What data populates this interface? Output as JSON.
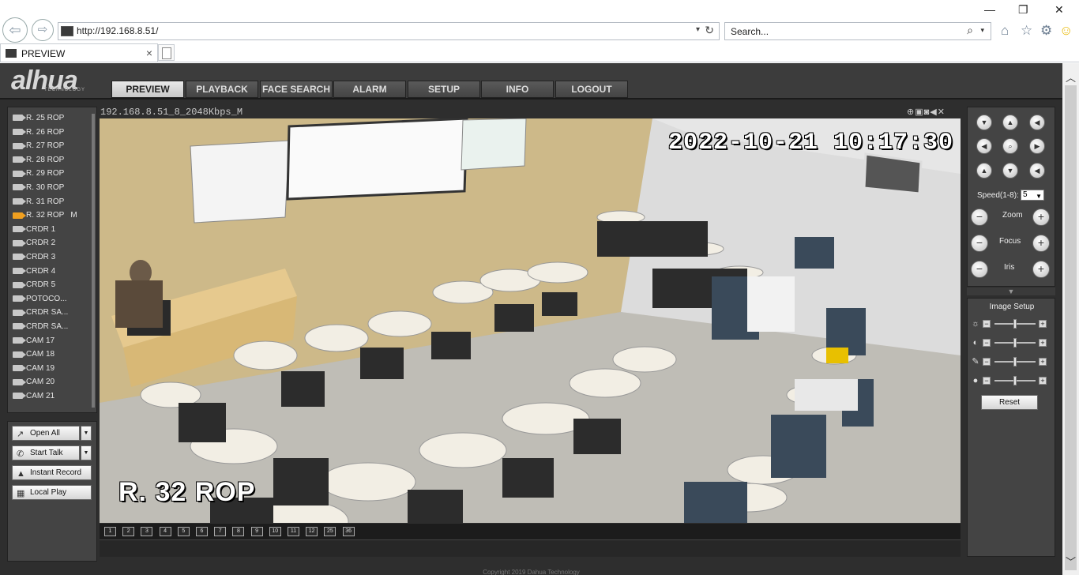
{
  "browser": {
    "url": "http://192.168.8.51/",
    "search_placeholder": "Search...",
    "tab_title": "PREVIEW"
  },
  "app": {
    "logo": "alhua",
    "logo_sub": "TECHNOLOGY",
    "menu": [
      "PREVIEW",
      "PLAYBACK",
      "FACE SEARCH",
      "ALARM",
      "SETUP",
      "INFO",
      "LOGOUT"
    ],
    "active_menu": "PREVIEW",
    "cameras": [
      {
        "label": "R. 25 ROP",
        "flag": ""
      },
      {
        "label": "R. 26 ROP",
        "flag": ""
      },
      {
        "label": "R. 27 ROP",
        "flag": ""
      },
      {
        "label": "R. 28 ROP",
        "flag": ""
      },
      {
        "label": "R. 29 ROP",
        "flag": ""
      },
      {
        "label": "R. 30 ROP",
        "flag": ""
      },
      {
        "label": "R. 31 ROP",
        "flag": ""
      },
      {
        "label": "R. 32 ROP",
        "flag": "M",
        "active": true
      },
      {
        "label": "CRDR 1",
        "flag": ""
      },
      {
        "label": "CRDR 2",
        "flag": ""
      },
      {
        "label": "CRDR 3",
        "flag": ""
      },
      {
        "label": "CRDR 4",
        "flag": ""
      },
      {
        "label": "CRDR 5",
        "flag": ""
      },
      {
        "label": "POTOCO...",
        "flag": ""
      },
      {
        "label": "CRDR SA...",
        "flag": ""
      },
      {
        "label": "CRDR SA...",
        "flag": ""
      },
      {
        "label": "CAM 17",
        "flag": ""
      },
      {
        "label": "CAM 18",
        "flag": ""
      },
      {
        "label": "CAM 19",
        "flag": ""
      },
      {
        "label": "CAM 20",
        "flag": ""
      },
      {
        "label": "CAM 21",
        "flag": ""
      }
    ],
    "controls": {
      "open_all": "Open All",
      "start_talk": "Start Talk",
      "instant_record": "Instant Record",
      "local_play": "Local Play"
    },
    "video": {
      "stream_title": "192.168.8.51_8_2048Kbps_M",
      "osd_time": "2022-10-21  10:17:30",
      "osd_name": "R. 32 ROP"
    },
    "ptz": {
      "speed_label": "Speed(1-8):",
      "speed_value": "5",
      "zoom_label": "Zoom",
      "focus_label": "Focus",
      "iris_label": "Iris"
    },
    "image_setup": {
      "title": "Image Setup",
      "reset": "Reset",
      "sliders": [
        {
          "icon": "brightness-icon",
          "glyph": "☼",
          "level": 0.5
        },
        {
          "icon": "contrast-icon",
          "glyph": "◐",
          "level": 0.5
        },
        {
          "icon": "saturation-icon",
          "glyph": "✎",
          "level": 0.5
        },
        {
          "icon": "hue-icon",
          "glyph": "●",
          "level": 0.5
        }
      ]
    },
    "layout_buttons": [
      "1",
      "2",
      "3",
      "4",
      "5",
      "6",
      "7",
      "8",
      "9",
      "10",
      "11",
      "12",
      "25",
      "36"
    ],
    "footer": "Copyright 2019 Dahua Technology"
  }
}
